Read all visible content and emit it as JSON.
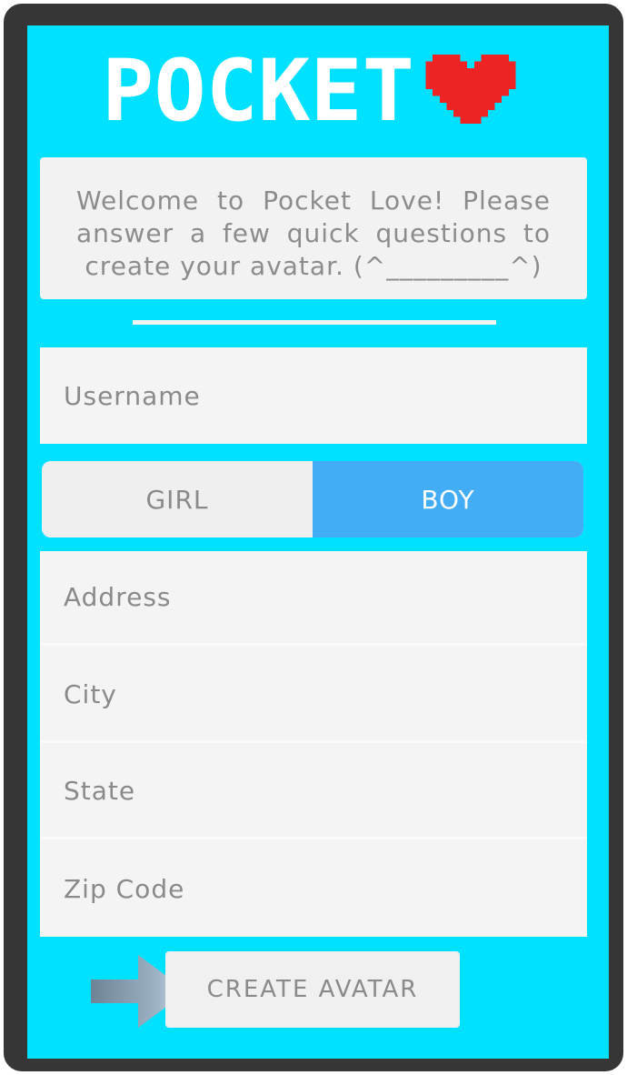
{
  "app": {
    "logo_text": "POCKET",
    "colors": {
      "screen_background": "#00e0ff",
      "heart": "#ee2424",
      "selected_toggle": "#42adf5",
      "device_frame": "#363636"
    }
  },
  "welcome": {
    "message": "Welcome to Pocket Love! Please answer a few quick questions to create your avatar. (^_________^)"
  },
  "form": {
    "username_placeholder": "Username",
    "gender": {
      "girl_label": "GIRL",
      "boy_label": "BOY",
      "selected": "BOY"
    },
    "address_placeholder": "Address",
    "city_placeholder": "City",
    "state_placeholder": "State",
    "zip_placeholder": "Zip Code",
    "submit_label": "CREATE AVATAR"
  },
  "icons": {
    "logo_heart": "heart-icon",
    "pointer_arrow": "arrow-right-icon"
  }
}
